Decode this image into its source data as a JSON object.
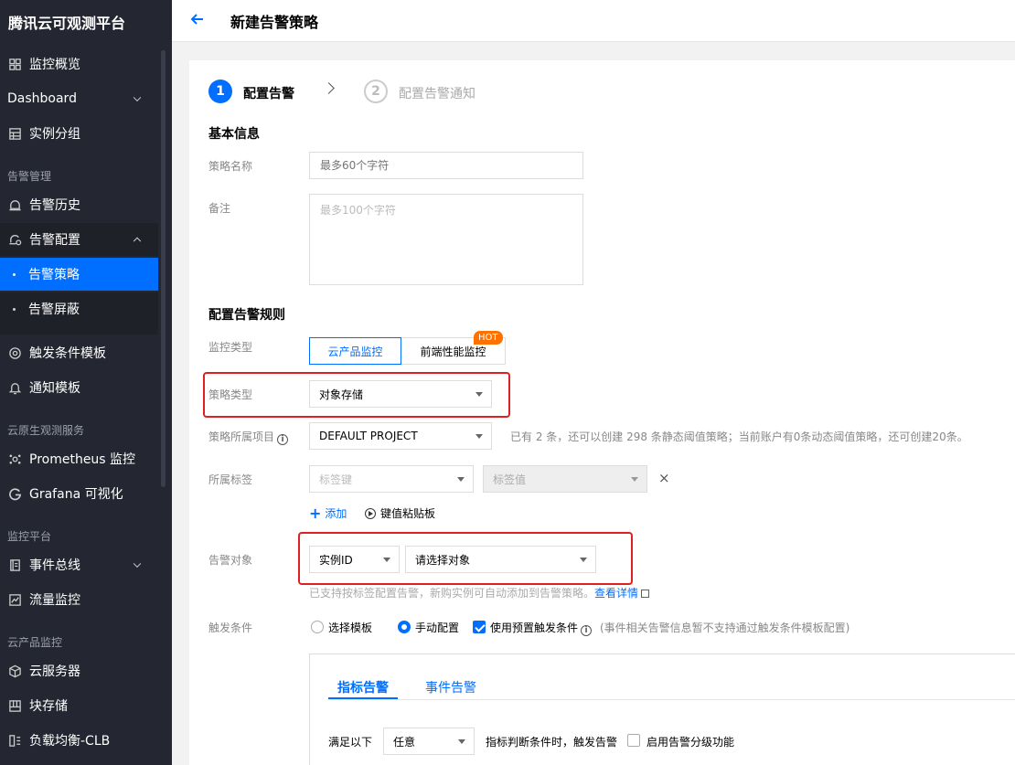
{
  "sidebar": {
    "app_title": "腾讯云可观测平台",
    "items": {
      "overview": "监控概览",
      "dashboard": "Dashboard",
      "instance_group": "实例分组",
      "alarm_history": "告警历史",
      "alarm_config": "告警配置",
      "alarm_policy": "告警策略",
      "alarm_shield": "告警屏蔽",
      "trigger_template": "触发条件模板",
      "notify_template": "通知模板",
      "prometheus": "Prometheus 监控",
      "grafana": "Grafana 可视化",
      "event_bus": "事件总线",
      "traffic_monitor": "流量监控",
      "cvm": "云服务器",
      "cbs": "块存储",
      "clb": "负载均衡-CLB"
    },
    "groups": {
      "alarm_mgmt": "告警管理",
      "cloud_native": "云原生观测服务",
      "monitor_platform": "监控平台",
      "cloud_product": "云产品监控"
    }
  },
  "header": {
    "title": "新建告警策略"
  },
  "steps": [
    {
      "num": "1",
      "label": "配置告警",
      "state": "active"
    },
    {
      "num": "2",
      "label": "配置告警通知",
      "state": "pending"
    }
  ],
  "basic": {
    "section_title": "基本信息",
    "name_label": "策略名称",
    "name_placeholder": "最多60个字符",
    "remark_label": "备注",
    "remark_placeholder": "最多100个字符"
  },
  "rules": {
    "section_title": "配置告警规则",
    "monitor_type_label": "监控类型",
    "monitor_types": [
      "云产品监控",
      "前端性能监控"
    ],
    "hot_badge": "HOT",
    "policy_type_label": "策略类型",
    "policy_type_value": "对象存储",
    "project_label": "策略所属项目",
    "project_value": "DEFAULT PROJECT",
    "project_hint": "已有 2 条，还可以创建 298 条静态阈值策略；当前账户有0条动态阈值策略，还可创建20条。",
    "tag_label": "所属标签",
    "tag_key_placeholder": "标签键",
    "tag_value_placeholder": "标签值",
    "add_label": "添加",
    "paste_label": "键值粘贴板",
    "target_label": "告警对象",
    "target_type_value": "实例ID",
    "target_select_placeholder": "请选择对象",
    "target_hint": "已支持按标签配置告警，新购实例可自动添加到告警策略。",
    "target_hint_link": "查看详情",
    "trigger_label": "触发条件",
    "trigger_options": [
      "选择模板",
      "手动配置"
    ],
    "preset_checkbox_label": "使用预置触发条件",
    "preset_hint": "(事件相关告警信息暂不支持通过触发条件模板配置)",
    "tabs": [
      "指标告警",
      "事件告警"
    ],
    "satisfy_label": "满足以下",
    "satisfy_value": "任意",
    "satisfy_suffix": "指标判断条件时，触发告警",
    "level_checkbox_label": "启用告警分级功能"
  },
  "colors": {
    "accent": "#006eff",
    "sidebar_bg": "#242731",
    "highlight": "#e02020",
    "hot_badge": "#ff7200"
  }
}
